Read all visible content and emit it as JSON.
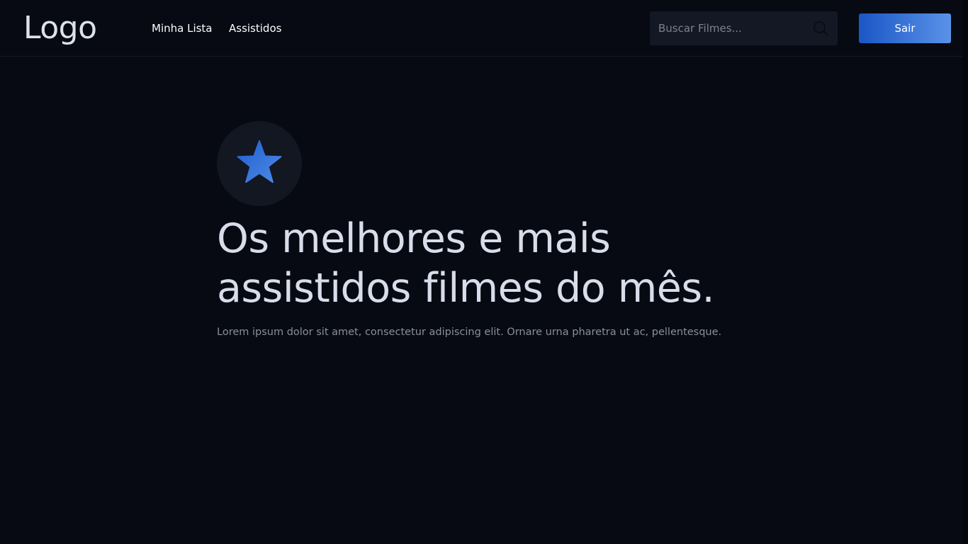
{
  "header": {
    "logo": "Logo",
    "nav": [
      {
        "label": "Minha Lista"
      },
      {
        "label": "Assistidos"
      }
    ],
    "search": {
      "placeholder": "Buscar Filmes...",
      "value": "",
      "icon": "search-icon"
    },
    "logout_label": "Sair"
  },
  "hero": {
    "badge_icon": "star-icon",
    "title_line1": "Os melhores e mais",
    "title_line2": "assistidos filmes do mês.",
    "description": "Lorem ipsum dolor sit amet, consectetur adipiscing elit. Ornare urna pharetra ut ac, pellentesque."
  },
  "colors": {
    "background": "#070a12",
    "accent_start": "#1a56c6",
    "accent_end": "#5a92e8",
    "surface": "#131824"
  }
}
